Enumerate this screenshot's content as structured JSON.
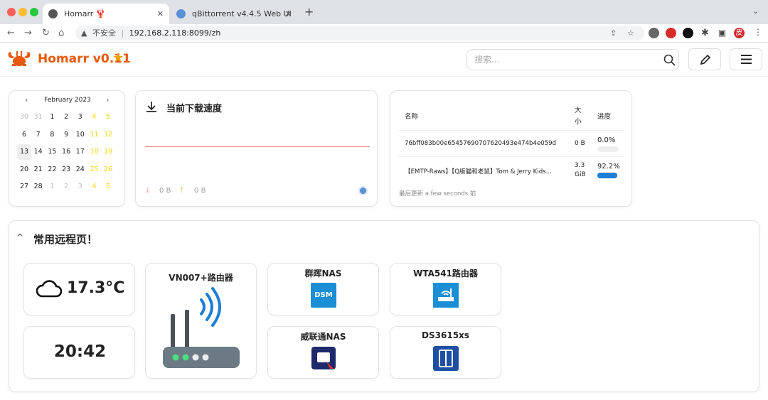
{
  "browser": {
    "tabs": [
      {
        "title": "Homarr 🦞"
      },
      {
        "title": "qBittorrent v4.4.5 Web UI"
      }
    ],
    "new_tab": "+",
    "security_label": "不安全",
    "url": "192.168.2.118:8099/zh",
    "profile": "皮"
  },
  "header": {
    "brand": "Homarr v0.11",
    "star": "★",
    "search_placeholder": "搜索..."
  },
  "calendar": {
    "month": "February 2023",
    "prev": "‹",
    "next": "›",
    "weeks": [
      [
        "30",
        "31",
        "1",
        "2",
        "3",
        "4",
        "5"
      ],
      [
        "6",
        "7",
        "8",
        "9",
        "10",
        "11",
        "12"
      ],
      [
        "13",
        "14",
        "15",
        "16",
        "17",
        "18",
        "19"
      ],
      [
        "20",
        "21",
        "22",
        "23",
        "24",
        "25",
        "26"
      ],
      [
        "27",
        "28",
        "1",
        "2",
        "3",
        "4",
        "5"
      ]
    ]
  },
  "download": {
    "title": "当前下载速度",
    "down": "0 B",
    "up": "0 B"
  },
  "torrents": {
    "col_name": "名称",
    "col_size": "大小",
    "col_progress": "进度",
    "rows": [
      {
        "name": "76bff083b00e65457690707620493e474b4e059d",
        "size": "0 B",
        "progress": "0.0%",
        "fraction": 0.0
      },
      {
        "name": "【EMTP-Raws】【Q版貓和老鼠】Tom & Jerry Kids...",
        "size": "3.3 GiB",
        "progress": "92.2%",
        "fraction": 0.922
      }
    ],
    "footer": "最后更新 a few seconds 前"
  },
  "category": {
    "title": "常用远程页！",
    "chevron": "^"
  },
  "weather": {
    "temp": "17.3°C"
  },
  "clock": {
    "time": "20:42"
  },
  "apps": {
    "router": "VN007+路由器",
    "nas1": "群晖NAS",
    "nas1_icon": "DSM",
    "wta": "WTA541路由器",
    "nas2": "威联通NAS",
    "ds": "DS3615xs"
  },
  "colors": {
    "accent": "#e8590c",
    "star": "#f59f00",
    "progress": "#1c7ed6",
    "weekend": "#f2d40a"
  }
}
